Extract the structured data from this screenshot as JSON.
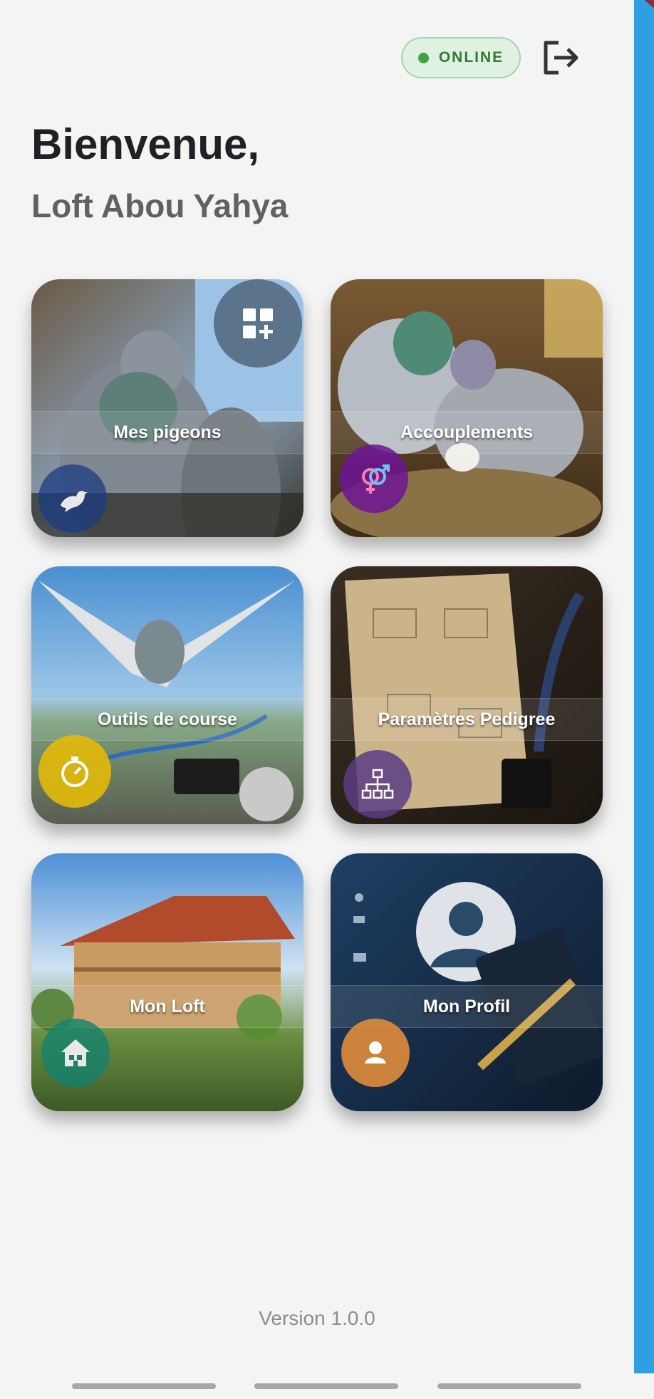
{
  "status": {
    "label": "ONLINE",
    "color": "#43a047"
  },
  "greeting": "Bienvenue,",
  "loft_name": "Loft Abou Yahya",
  "tiles": [
    {
      "label": "Mes pigeons",
      "icon": "dove-icon"
    },
    {
      "label": "Accouplements",
      "icon": "male-female-icon"
    },
    {
      "label": "Outils de course",
      "icon": "stopwatch-icon"
    },
    {
      "label": "Paramètres Pedigree",
      "icon": "hierarchy-icon"
    },
    {
      "label": "Mon Loft",
      "icon": "house-icon"
    },
    {
      "label": "Mon Profil",
      "icon": "person-icon"
    }
  ],
  "add_widget_icon": "grid-add-icon",
  "logout_icon": "logout-icon",
  "version": "Version 1.0.0"
}
